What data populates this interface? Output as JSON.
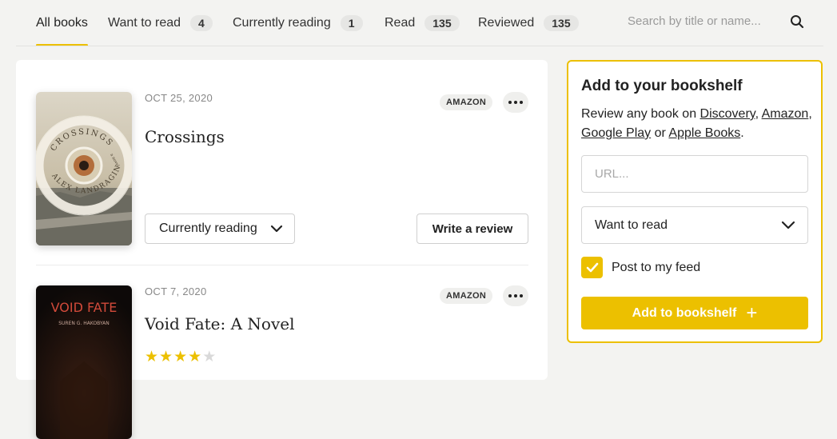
{
  "tabs": [
    {
      "label": "All books",
      "count": null
    },
    {
      "label": "Want to read",
      "count": "4"
    },
    {
      "label": "Currently reading",
      "count": "1"
    },
    {
      "label": "Read",
      "count": "135"
    },
    {
      "label": "Reviewed",
      "count": "135"
    }
  ],
  "search": {
    "placeholder": "Search by title or name..."
  },
  "books": [
    {
      "date": "OCT 25, 2020",
      "title": "Crossings",
      "store": "AMAZON",
      "status": "Currently reading",
      "review_label": "Write a review",
      "cover": {
        "title": "CROSSINGS",
        "author": "ALEX LANDRAGIN",
        "tag": "a novel"
      }
    },
    {
      "date": "OCT 7, 2020",
      "title": "Void Fate: A Novel",
      "store": "AMAZON",
      "rating": 4,
      "rating_max": 5,
      "cover": {
        "title": "VOID FATE",
        "author": "SUREN G. HAKOBYAN"
      }
    }
  ],
  "panel": {
    "title": "Add to your bookshelf",
    "desc_prefix": "Review any book on",
    "links": [
      "Discovery",
      "Amazon",
      "Google Play",
      "Apple Books"
    ],
    "desc_or": "or",
    "url_placeholder": "URL...",
    "shelf_value": "Want to read",
    "post_feed_label": "Post to my feed",
    "post_feed_checked": true,
    "add_button": "Add to bookshelf"
  },
  "colors": {
    "accent": "#ecc000"
  }
}
